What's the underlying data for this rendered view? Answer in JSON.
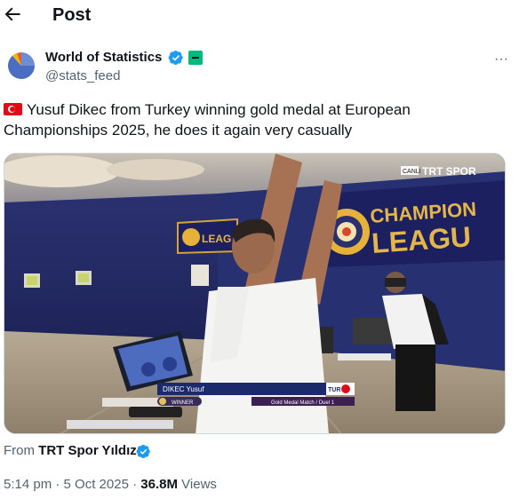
{
  "header": {
    "title": "Post",
    "back_icon": "arrow-left-icon"
  },
  "author": {
    "name": "World of Statistics",
    "handle": "@stats_feed",
    "verified": true,
    "affiliate_badge_color": "#00ba7c",
    "verified_color": "#1d9bf0",
    "more_label": "···"
  },
  "tweet": {
    "flag_icon": "turkey-flag-icon",
    "line1": "Yusuf Dikec from Turkey winning gold medal at European",
    "line2": "Championships 2025, he does it again very casually"
  },
  "media": {
    "broadcaster_live": "CANLI",
    "broadcaster_name": "TRT SPOR",
    "banner_text_1": "CHAMPION",
    "banner_text_2": "LEAGU",
    "banner_small": "LEAG",
    "scoreboard": {
      "athlete": "DIKEC Yusuf",
      "country": "TUR",
      "status": "WINNER",
      "match": "Gold Medal Match / Duel 1"
    }
  },
  "footer": {
    "from_label": "From",
    "source_name": "TRT Spor Yıldız",
    "time": "5:14 pm",
    "separator": "·",
    "date": "5 Oct 2025",
    "views_count": "36.8M",
    "views_label": "Views"
  }
}
